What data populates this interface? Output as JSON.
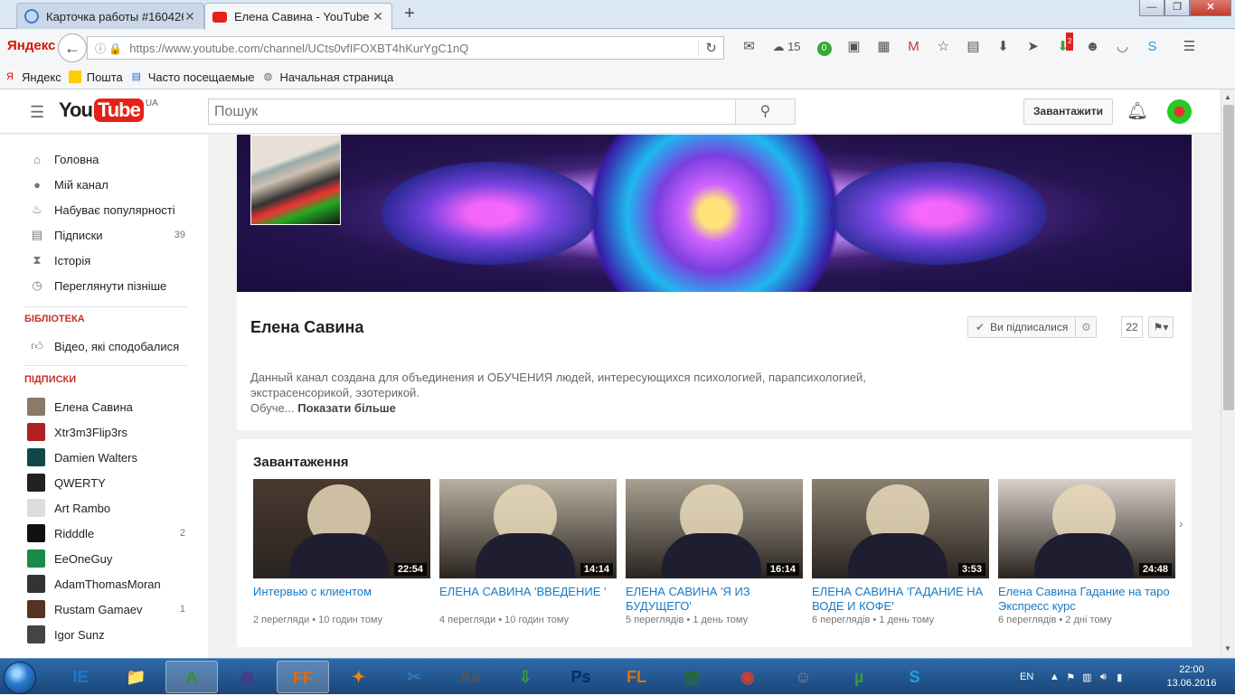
{
  "browser": {
    "tabs": [
      {
        "title": "Карточка работы #160426...",
        "active": false
      },
      {
        "title": "Елена Савина - YouTube",
        "active": true
      }
    ],
    "new_tab": "+",
    "window_controls": {
      "min": "—",
      "max": "❐",
      "close": "✕"
    },
    "yandex_logo": "Яндекс",
    "url": "https://www.youtube.com/channel/UCts0vfIFOXBT4hKurYgC1nQ",
    "weather_temp": "15",
    "toolbar_badges": {
      "green": "0",
      "red": "2"
    },
    "bookmarks": [
      "Яндекс",
      "Пошта",
      "Часто посещаемые",
      "Начальная страница"
    ]
  },
  "youtube": {
    "logo_you": "You",
    "logo_tube": "Tube",
    "logo_region": "UA",
    "search_placeholder": "Пошук",
    "upload_label": "Завантажити",
    "sidebar": {
      "nav": [
        {
          "label": "Головна",
          "icon": "home-icon"
        },
        {
          "label": "Мій канал",
          "icon": "account-icon"
        },
        {
          "label": "Набуває популярності",
          "icon": "flame-icon"
        },
        {
          "label": "Підписки",
          "icon": "subscriptions-icon",
          "count": "39"
        },
        {
          "label": "Історія",
          "icon": "hourglass-icon"
        },
        {
          "label": "Переглянути пізніше",
          "icon": "clock-icon"
        }
      ],
      "library_heading": "БІБЛІОТЕКА",
      "library": [
        {
          "label": "Відео, які сподобалися",
          "icon": "thumbs-up-icon"
        }
      ],
      "subs_heading": "ПІДПИСКИ",
      "subscriptions": [
        {
          "label": "Елена Савина",
          "count": "",
          "color": "#8a7a6a"
        },
        {
          "label": "Xtr3m3Flip3rs",
          "count": "",
          "color": "#b02020"
        },
        {
          "label": "Damien Walters",
          "count": "",
          "color": "#104848"
        },
        {
          "label": "QWERTY",
          "count": "",
          "color": "#222222"
        },
        {
          "label": "Art Rambo",
          "count": "",
          "color": "#dddddd"
        },
        {
          "label": "Ridddle",
          "count": "2",
          "color": "#111111"
        },
        {
          "label": "EeOneGuy",
          "count": "",
          "color": "#1a8a4a"
        },
        {
          "label": "AdamThomasMoran",
          "count": "",
          "color": "#333333"
        },
        {
          "label": "Rustam Gamaev",
          "count": "1",
          "color": "#553322"
        },
        {
          "label": "Igor Sunz",
          "count": "",
          "color": "#444444"
        }
      ]
    },
    "channel": {
      "name": "Елена Савина",
      "subscribed_label": "Ви підписалися",
      "subscriber_count": "22",
      "description": "Данный канал создана для объединения и ОБУЧЕНИЯ людей, интересующихся психологией, парапсихологией, экстрасенсорикой, эзотерикой.",
      "description_more_prefix": "Обуче...",
      "show_more": "Показати більше"
    },
    "uploads": {
      "heading": "Завантаження",
      "videos": [
        {
          "title": "Интервью с клиентом",
          "duration": "22:54",
          "views": "2 перегляди",
          "age": "10 годин тому",
          "thumb": "#4a3a30"
        },
        {
          "title": "ЕЛЕНА САВИНА 'ВВЕДЕНИЕ '",
          "duration": "14:14",
          "views": "4 перегляди",
          "age": "10 годин тому",
          "thumb": "#b8b0a0"
        },
        {
          "title": "ЕЛЕНА САВИНА 'Я ИЗ БУДУЩЕГО'",
          "duration": "16:14",
          "views": "5 переглядів",
          "age": "1 день тому",
          "thumb": "#a8a090"
        },
        {
          "title": "ЕЛЕНА САВИНА 'ГАДАНИЕ НА ВОДЕ И КОФЕ'",
          "duration": "3:53",
          "views": "6 переглядів",
          "age": "1 день тому",
          "thumb": "#8a8070"
        },
        {
          "title": "Елена Савина Гадание на таро Экспресс курс",
          "duration": "24:48",
          "views": "6 переглядів",
          "age": "2 дні тому",
          "thumb": "#d8d0c8"
        }
      ]
    }
  },
  "taskbar": {
    "apps": [
      "IE",
      "📁",
      "A",
      "◎",
      "FF",
      "✦",
      "✂",
      "Ae",
      "⇩",
      "Ps",
      "FL",
      "▤",
      "◉",
      "☺",
      "µ",
      "S"
    ],
    "language": "EN",
    "time": "22:00",
    "date": "13.06.2016"
  }
}
